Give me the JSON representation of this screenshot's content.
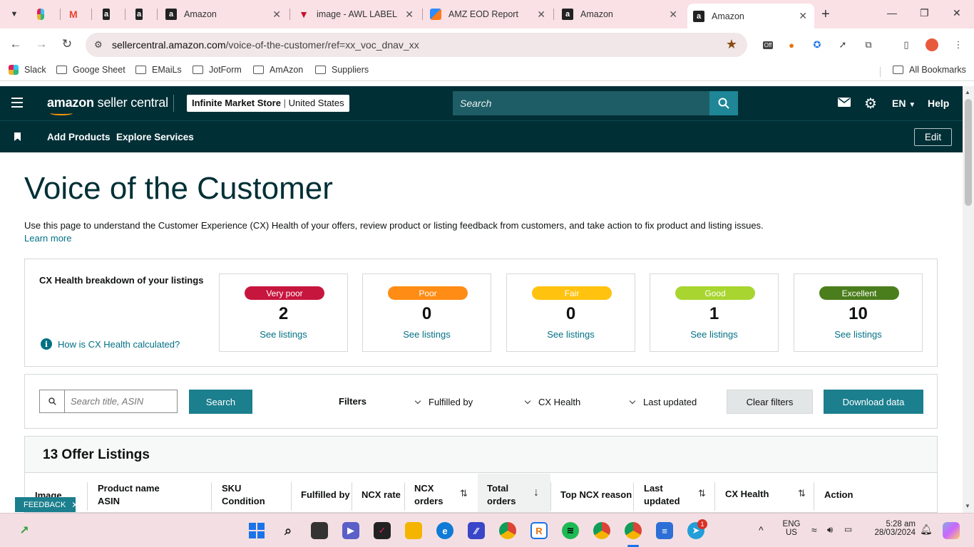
{
  "browser": {
    "tabs": [
      {
        "title": "",
        "icon": "slack-icon"
      },
      {
        "title": "",
        "icon": "gmail-icon"
      },
      {
        "title": "",
        "icon": "amazon-icon"
      },
      {
        "title": "",
        "icon": "amazon-icon"
      },
      {
        "title": "Amazon",
        "icon": "amazon-icon"
      },
      {
        "title": "image - AWL LABEL",
        "icon": "label-icon"
      },
      {
        "title": "AMZ EOD Report",
        "icon": "report-icon"
      },
      {
        "title": "Amazon",
        "icon": "amazon-icon"
      },
      {
        "title": "Amazon",
        "icon": "amazon-icon",
        "active": true
      }
    ],
    "url_domain": "sellercentral.amazon.com",
    "url_path": "/voice-of-the-customer/ref=xx_voc_dnav_xx",
    "bookmarks": [
      "Slack",
      "Googe Sheet",
      "EMaiLs",
      "JotForm",
      "AmAzon",
      "Suppliers"
    ],
    "all_bookmarks": "All Bookmarks",
    "ext_off_badge": "Off"
  },
  "header": {
    "logo_brand": "amazon",
    "logo_text": "seller central",
    "store_name": "Infinite Market Store",
    "store_region": "United States",
    "search_placeholder": "Search",
    "language": "EN",
    "help": "Help"
  },
  "subnav": {
    "links": [
      "Add Products",
      "Explore Services"
    ],
    "edit": "Edit"
  },
  "page": {
    "title": "Voice of the Customer",
    "intro": "Use this page to understand the Customer Experience (CX) Health of your offers, review product or listing feedback from customers, and take action to fix product and listing issues.",
    "learn_more": "Learn more"
  },
  "cx_health": {
    "title": "CX Health breakdown of your listings",
    "how_link": "How is CX Health calculated?",
    "info_glyph": "i",
    "cards": [
      {
        "label": "Very poor",
        "count": "2",
        "link": "See listings",
        "color": "#c7163e",
        "text_color": "#ffffff"
      },
      {
        "label": "Poor",
        "count": "0",
        "link": "See listings",
        "color": "#ff8c14",
        "text_color": "#ffffff"
      },
      {
        "label": "Fair",
        "count": "0",
        "link": "See listings",
        "color": "#ffc20e",
        "text_color": "#ffffff"
      },
      {
        "label": "Good",
        "count": "1",
        "link": "See listings",
        "color": "#a8d52f",
        "text_color": "#ffffff"
      },
      {
        "label": "Excellent",
        "count": "10",
        "link": "See listings",
        "color": "#4a7d1b",
        "text_color": "#ffffff"
      }
    ]
  },
  "filters": {
    "search_placeholder": "Search title, ASIN",
    "search_button": "Search",
    "label": "Filters",
    "dropdowns": [
      "Fulfilled by",
      "CX Health",
      "Last updated"
    ],
    "clear": "Clear filters",
    "download": "Download data"
  },
  "listings": {
    "title": "13 Offer Listings",
    "columns": [
      {
        "line1": "Image",
        "line2": ""
      },
      {
        "line1": "Product name",
        "line2": "ASIN"
      },
      {
        "line1": "SKU",
        "line2": "Condition"
      },
      {
        "line1": "Fulfilled by",
        "line2": ""
      },
      {
        "line1": "NCX rate",
        "line2": ""
      },
      {
        "line1": "NCX",
        "line2": "orders"
      },
      {
        "line1": "Total",
        "line2": "orders"
      },
      {
        "line1": "Top NCX reason",
        "line2": ""
      },
      {
        "line1": "Last",
        "line2": "updated"
      },
      {
        "line1": "CX Health",
        "line2": ""
      },
      {
        "line1": "Action",
        "line2": ""
      }
    ]
  },
  "feedback": "FEEDBACK",
  "taskbar": {
    "lang_line1": "ENG",
    "lang_line2": "US",
    "time": "5:28 am",
    "date": "28/03/2024",
    "telegram_badge": "1"
  }
}
